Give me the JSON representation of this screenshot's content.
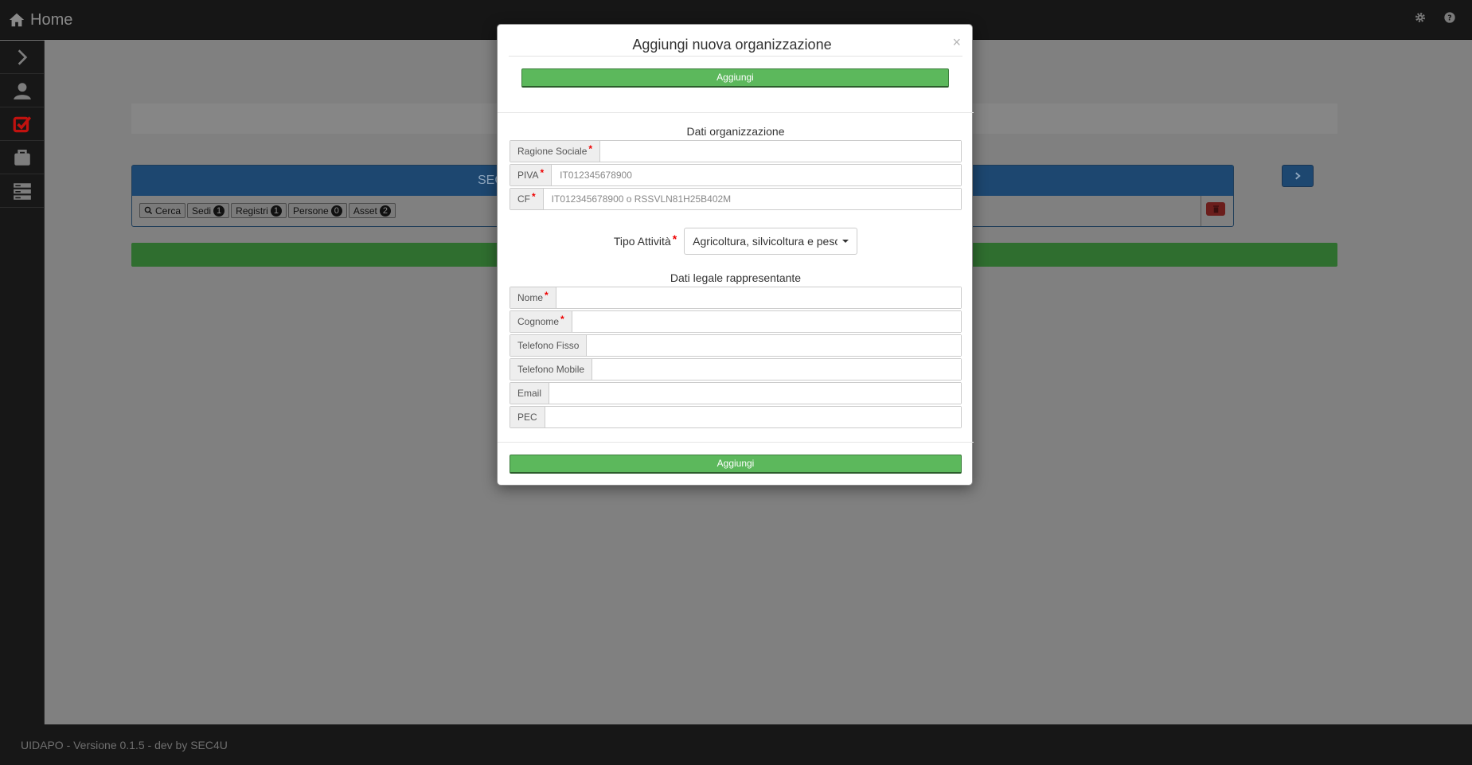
{
  "navbar": {
    "brand": "Home",
    "icons": [
      "home-icon",
      "gear-icon",
      "help-icon"
    ]
  },
  "sidebar": {
    "icons": [
      "chevron-right-icon",
      "user-icon",
      "checkbox-icon",
      "briefcase-icon",
      "server-icon"
    ]
  },
  "background": {
    "panel_title": "SEC",
    "tabs": [
      {
        "label": "Cerca",
        "icon": "search-icon"
      },
      {
        "label": "Sedi",
        "count": "1"
      },
      {
        "label": "Registri",
        "count": "1"
      },
      {
        "label": "Persone",
        "count": "0"
      },
      {
        "label": "Asset",
        "count": "2"
      }
    ]
  },
  "modal": {
    "title": "Aggiungi nuova organizzazione",
    "close": "×",
    "add_top": "Aggiungi",
    "section_org": "Dati organizzazione",
    "fields_org": [
      {
        "label": "Ragione Sociale",
        "required": "*",
        "value": "",
        "placeholder": ""
      },
      {
        "label": "PIVA",
        "required": "*",
        "value": "",
        "placeholder": "IT012345678900"
      },
      {
        "label": "CF",
        "required": "*",
        "value": "",
        "placeholder": "IT012345678900 o RSSVLN81H25B402M"
      }
    ],
    "tipo_attivita": {
      "label": "Tipo Attività",
      "required": "*",
      "selected": "Agricoltura, silvicoltura e pesca"
    },
    "section_legal": "Dati legale rappresentante",
    "fields_legal": [
      {
        "label": "Nome",
        "required": "*",
        "value": ""
      },
      {
        "label": "Cognome",
        "required": "*",
        "value": ""
      },
      {
        "label": "Telefono Fisso",
        "value": ""
      },
      {
        "label": "Telefono Mobile",
        "value": ""
      },
      {
        "label": "Email",
        "value": ""
      },
      {
        "label": "PEC",
        "value": ""
      }
    ],
    "add_bottom": "Aggiungi"
  },
  "footer": {
    "text": "UIDAPO - Versione 0.1.5 - dev by SEC4U"
  },
  "colors": {
    "primary": "#1d4770",
    "success": "#5cb85c",
    "danger": "#d9534f",
    "accent_red": "#e00000"
  }
}
